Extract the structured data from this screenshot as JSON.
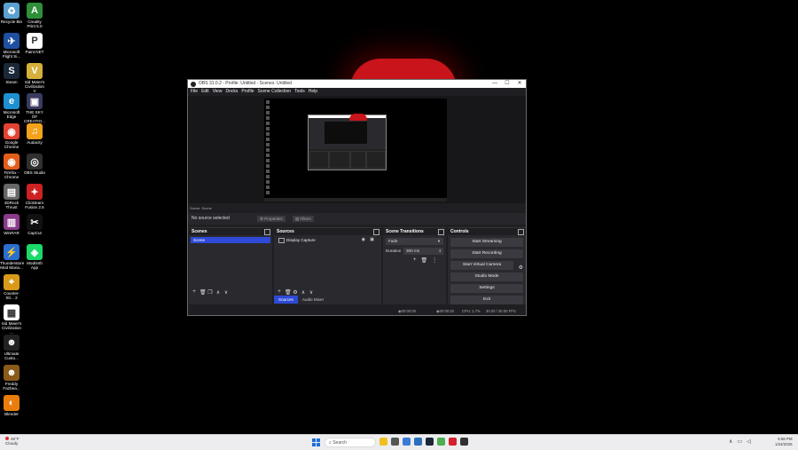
{
  "desktop": {
    "icons": [
      {
        "label": "Recycle Bin",
        "icon": "recycle-bin-icon",
        "color": "#5aa0d0",
        "glyph": "♻"
      },
      {
        "label": "Creality Print 5.0",
        "icon": "creality-icon",
        "color": "#2f8f3a",
        "glyph": "A"
      },
      {
        "label": "Microsoft Flight Si...",
        "icon": "flight-sim-icon",
        "color": "#1f4fa0",
        "glyph": "✈"
      },
      {
        "label": "Paint.NET",
        "icon": "paintnet-icon",
        "color": "#ffffff",
        "glyph": "P"
      },
      {
        "label": "Steam",
        "icon": "steam-icon",
        "color": "#1b2838",
        "glyph": "S"
      },
      {
        "label": "Sid Meier's Civilization V",
        "icon": "civ5-icon",
        "color": "#d6b03a",
        "glyph": "V"
      },
      {
        "label": "Microsoft Edge",
        "icon": "edge-icon",
        "color": "#1e8fd0",
        "glyph": "e"
      },
      {
        "label": "THE SKY OF CREATIO...",
        "icon": "sky-icon",
        "color": "#3a3a60",
        "glyph": "▣"
      },
      {
        "label": "Google Chrome",
        "icon": "chrome-icon",
        "color": "#e34133",
        "glyph": "◉"
      },
      {
        "label": "Audacity",
        "icon": "audacity-icon",
        "color": "#f3a21a",
        "glyph": "♫"
      },
      {
        "label": "Firefox - Chrome",
        "icon": "firefox-icon",
        "color": "#e35d1a",
        "glyph": "◉"
      },
      {
        "label": "OBS Studio",
        "icon": "obs-icon",
        "color": "#303030",
        "glyph": "◎"
      },
      {
        "label": "4DRock Thrust",
        "icon": "4drock-icon",
        "color": "#666666",
        "glyph": "▤"
      },
      {
        "label": "Clickteam Fusion 2.5",
        "icon": "clickteam-icon",
        "color": "#cc2222",
        "glyph": "✦"
      },
      {
        "label": "WinRAR",
        "icon": "winrar-icon",
        "color": "#8a3a8a",
        "glyph": "▥"
      },
      {
        "label": "CapCut",
        "icon": "capcut-icon",
        "color": "#111111",
        "glyph": "✂"
      },
      {
        "label": "Thunderstore Mod Mana...",
        "icon": "thunderstore-icon",
        "color": "#2a6fd0",
        "glyph": "⚡"
      },
      {
        "label": "Modrinth App",
        "icon": "modrinth-icon",
        "color": "#1bd96a",
        "glyph": "◈"
      },
      {
        "label": "Counter-Str... 2",
        "icon": "cs2-icon",
        "color": "#d99a1a",
        "glyph": "⌖"
      },
      {
        "label": "Sid Meier's Civilization ...",
        "icon": "civ6-icon",
        "color": "#ffffff",
        "glyph": "▦"
      },
      {
        "label": "Ultimate Custo...",
        "icon": "ucn-icon",
        "color": "#222222",
        "glyph": "☻"
      },
      {
        "label": "Freddy Fazbea...",
        "icon": "freddy-icon",
        "color": "#8a5a1a",
        "glyph": "☻"
      },
      {
        "label": "Blender",
        "icon": "blender-icon",
        "color": "#e87d0d",
        "glyph": "◐"
      }
    ]
  },
  "obs": {
    "title": "OBS 31.0.2 - Profile: Untitled - Scenes: Untitled",
    "window_controls": [
      "—",
      "☐",
      "✕"
    ],
    "menu": [
      "File",
      "Edit",
      "View",
      "Docks",
      "Profile",
      "Scene Collection",
      "Tools",
      "Help"
    ],
    "scene_selector": "Scene: Scene",
    "source_bar": {
      "no_source": "No source selected",
      "properties": "Properties",
      "filters": "Filters"
    },
    "scenes": {
      "title": "Scenes",
      "items": [
        "Scene"
      ],
      "tools": [
        "+",
        "🗑",
        "❐",
        "∧",
        "∨"
      ]
    },
    "sources": {
      "title": "Sources",
      "items": [
        "Display Capture"
      ],
      "tools": [
        "+",
        "🗑",
        "⚙",
        "∧",
        "∨"
      ]
    },
    "transitions": {
      "title": "Scene Transitions",
      "selected": "Fade",
      "duration_label": "Duration",
      "duration_value": "300 ms"
    },
    "controls": {
      "title": "Controls",
      "buttons": [
        "Start Streaming",
        "Start Recording",
        "Start Virtual Camera",
        "Studio Mode",
        "Settings",
        "Exit"
      ]
    },
    "bottom_tabs": [
      "Sources",
      "Audio Mixer"
    ],
    "status": {
      "stream_time": "00:00:00",
      "rec_time": "00:00:00",
      "cpu": "CPU: 1.7%",
      "fps": "30.00 / 30.00 FPS"
    }
  },
  "taskbar": {
    "weather_temp": "46°F",
    "weather_desc": "Cloudy",
    "search_placeholder": "Search",
    "apps": [
      {
        "name": "explorer-icon",
        "color": "#f0c020"
      },
      {
        "name": "widgets-icon",
        "color": "#555555"
      },
      {
        "name": "files-icon",
        "color": "#3a7bd5"
      },
      {
        "name": "store-icon",
        "color": "#2c6fbd"
      },
      {
        "name": "steam-task-icon",
        "color": "#1b2838"
      },
      {
        "name": "minecraft-icon",
        "color": "#4caf50"
      },
      {
        "name": "opera-icon",
        "color": "#d3212d"
      },
      {
        "name": "obs-task-icon",
        "color": "#303030"
      }
    ],
    "time": "5:58 PM",
    "date": "1/24/2025"
  }
}
